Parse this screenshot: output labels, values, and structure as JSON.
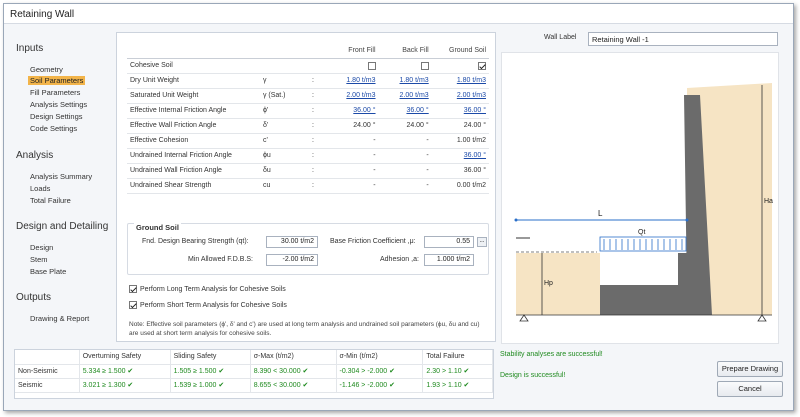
{
  "window": {
    "title": "Retaining Wall"
  },
  "sidebar": {
    "sections": [
      {
        "title": "Inputs",
        "items": [
          "Geometry",
          "Soil Parameters",
          "Fill Parameters",
          "Analysis Settings",
          "Design Settings",
          "Code Settings"
        ]
      },
      {
        "title": "Analysis",
        "items": [
          "Analysis Summary",
          "Loads",
          "Total Failure"
        ]
      },
      {
        "title": "Design and Detailing",
        "items": [
          "Design",
          "Stem",
          "Base Plate"
        ]
      },
      {
        "title": "Outputs",
        "items": [
          "Drawing & Report"
        ]
      }
    ],
    "active_item": "Soil Parameters"
  },
  "params": {
    "headers": [
      "Front Fill",
      "Back Fill",
      "Ground Soil"
    ],
    "cohesive_label": "Cohesive Soil",
    "cohesive": {
      "front": false,
      "back": false,
      "ground": true
    },
    "rows": [
      {
        "label": "Dry Unit Weight",
        "sym": "γ",
        "colon": ":",
        "front": "1.80 t/m3",
        "back": "1.80 t/m3",
        "ground": "1.80 t/m3",
        "link": [
          true,
          true,
          true
        ]
      },
      {
        "label": "Saturated Unit Weight",
        "sym": "γ (Sat.)",
        "colon": ":",
        "front": "2.00 t/m3",
        "back": "2.00 t/m3",
        "ground": "2.00 t/m3",
        "link": [
          true,
          true,
          true
        ]
      },
      {
        "label": "Effective Internal Friction Angle",
        "sym": "ϕ'",
        "colon": ":",
        "front": "36.00 °",
        "back": "36.00 °",
        "ground": "36.00 °",
        "link": [
          true,
          true,
          true
        ]
      },
      {
        "label": "Effective Wall Friction Angle",
        "sym": "δ'",
        "colon": ":",
        "front": "24.00 °",
        "back": "24.00 °",
        "ground": "24.00 °",
        "link": [
          false,
          false,
          false
        ]
      },
      {
        "label": "Effective Cohesion",
        "sym": "c'",
        "colon": ":",
        "front": "-",
        "back": "-",
        "ground": "1.00 t/m2",
        "link": [
          false,
          false,
          false
        ]
      },
      {
        "label": "Undrained Internal Friction Angle",
        "sym": "ϕu",
        "colon": ":",
        "front": "-",
        "back": "-",
        "ground": "36.00 °",
        "link": [
          false,
          false,
          true
        ]
      },
      {
        "label": "Undrained Wall Friction Angle",
        "sym": "δu",
        "colon": ":",
        "front": "-",
        "back": "-",
        "ground": "36.00 °",
        "link": [
          false,
          false,
          false
        ]
      },
      {
        "label": "Undrained Shear Strength",
        "sym": "cu",
        "colon": ":",
        "front": "-",
        "back": "-",
        "ground": "0.00 t/m2",
        "link": [
          false,
          false,
          false
        ]
      }
    ]
  },
  "ground_soil": {
    "title": "Ground Soil",
    "bearing_label": "Fnd. Design Bearing Strength (qt):",
    "bearing_value": "30.00 t/m2",
    "fdbs_label": "Min Allowed F.D.B.S:",
    "fdbs_value": "-2.00 t/m2",
    "friction_label": "Base Friction Coefficient ,μ:",
    "friction_value": "0.55",
    "adhesion_label": "Adhesion ,a:",
    "adhesion_value": "1.000 t/m2",
    "more_button": "..."
  },
  "options": {
    "long_term": "Perform Long Term Analysis for Cohesive Soils",
    "short_term": "Perform Short Term Analysis for Cohesive Soils",
    "long_checked": true,
    "short_checked": true
  },
  "note": "Note: Effective soil parameters (ϕ', δ' and c') are used at long term analysis and undrained soil parameters (ϕu, δu and cu) are used at short term analysis for cohesive soils.",
  "wall_label": {
    "label": "Wall Label",
    "value": "Retaining Wall -1"
  },
  "diagram": {
    "labels": {
      "L": "L",
      "Qt": "Qt",
      "Ha": "Ha",
      "Hp": "Hp"
    },
    "colors": {
      "soil": "#f6e4c4",
      "wall": "#6b6b6b",
      "load": "#2a6fc9"
    }
  },
  "results": {
    "headers": [
      "",
      "Overturning Safety",
      "Sliding Safety",
      "σ-Max (t/m2)",
      "σ-Min (t/m2)",
      "Total Failure"
    ],
    "rows": [
      [
        "Non-Seismic",
        "5.334 ≥ 1.500 ✔",
        "1.505 ≥ 1.500 ✔",
        "8.390 < 30.000 ✔",
        "-0.304 > -2.000 ✔",
        "2.30 > 1.10 ✔"
      ],
      [
        "Seismic",
        "3.021 ≥ 1.300 ✔",
        "1.539 ≥ 1.000 ✔",
        "8.655 < 30.000 ✔",
        "-1.146 > -2.000 ✔",
        "1.93 > 1.10 ✔"
      ]
    ]
  },
  "status": {
    "stability": "Stability analyses are successful!",
    "design": "Design is successful!"
  },
  "buttons": {
    "prepare": "Prepare Drawing",
    "cancel": "Cancel"
  }
}
